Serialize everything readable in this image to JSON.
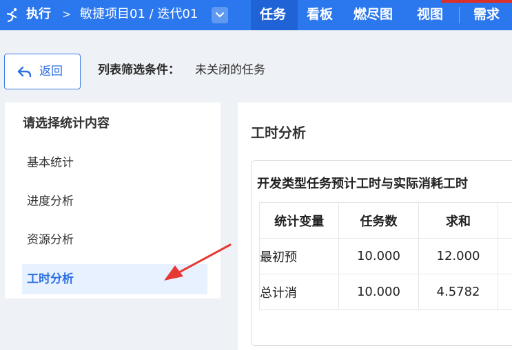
{
  "header": {
    "run_label": "执行",
    "crumb_sep": ">",
    "project": "敏捷项目01 / 迭代01",
    "tabs": [
      "任务",
      "看板",
      "燃尽图",
      "视图",
      "需求"
    ],
    "active_tab": "任务",
    "colors": {
      "bar": "#2b77ee",
      "active_tab": "#1f63d6"
    }
  },
  "toolbar": {
    "back_label": "返回",
    "filter_label": "列表筛选条件：",
    "filter_value": "未关闭的任务"
  },
  "sidebar": {
    "title": "请选择统计内容",
    "items": [
      {
        "label": "基本统计"
      },
      {
        "label": "进度分析"
      },
      {
        "label": "资源分析"
      },
      {
        "label": "工时分析"
      }
    ],
    "active_index": 3
  },
  "main": {
    "title": "工时分析",
    "card_title": "开发类型任务预计工时与实际消耗工时",
    "table": {
      "headers": [
        "统计变量",
        "任务数",
        "求和"
      ],
      "rows": [
        [
          "最初预",
          "10.000",
          "12.000"
        ],
        [
          "总计消",
          "10.000",
          "4.5782"
        ]
      ]
    }
  },
  "icons": [
    "run-icon",
    "chevron-right-icon",
    "chevron-down-icon",
    "back-arrow-icon",
    "annotation-arrow-icon"
  ]
}
